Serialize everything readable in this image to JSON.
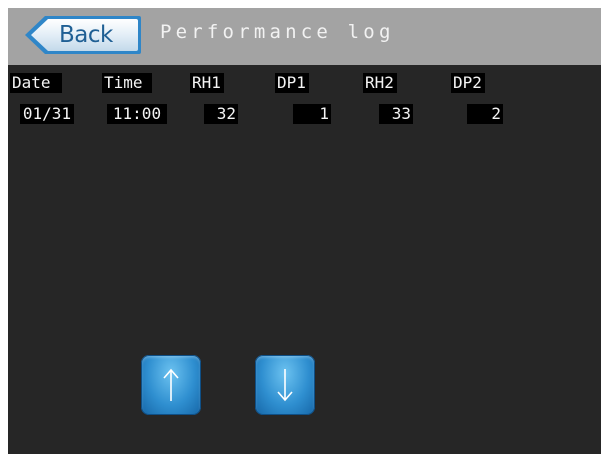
{
  "header": {
    "back_label": "Back",
    "title": "Performance log"
  },
  "table": {
    "columns": [
      "Date",
      "Time",
      "RH1",
      "DP1",
      "RH2",
      "DP2"
    ],
    "rows": [
      [
        "01/31",
        "11:00",
        "32",
        "1",
        "33",
        "2"
      ]
    ]
  },
  "nav": {
    "up_icon": "arrow-up-icon",
    "down_icon": "arrow-down-icon"
  },
  "colors": {
    "background": "#262626",
    "titlebar": "#a3a3a3",
    "accent": "#2f8fd0"
  }
}
